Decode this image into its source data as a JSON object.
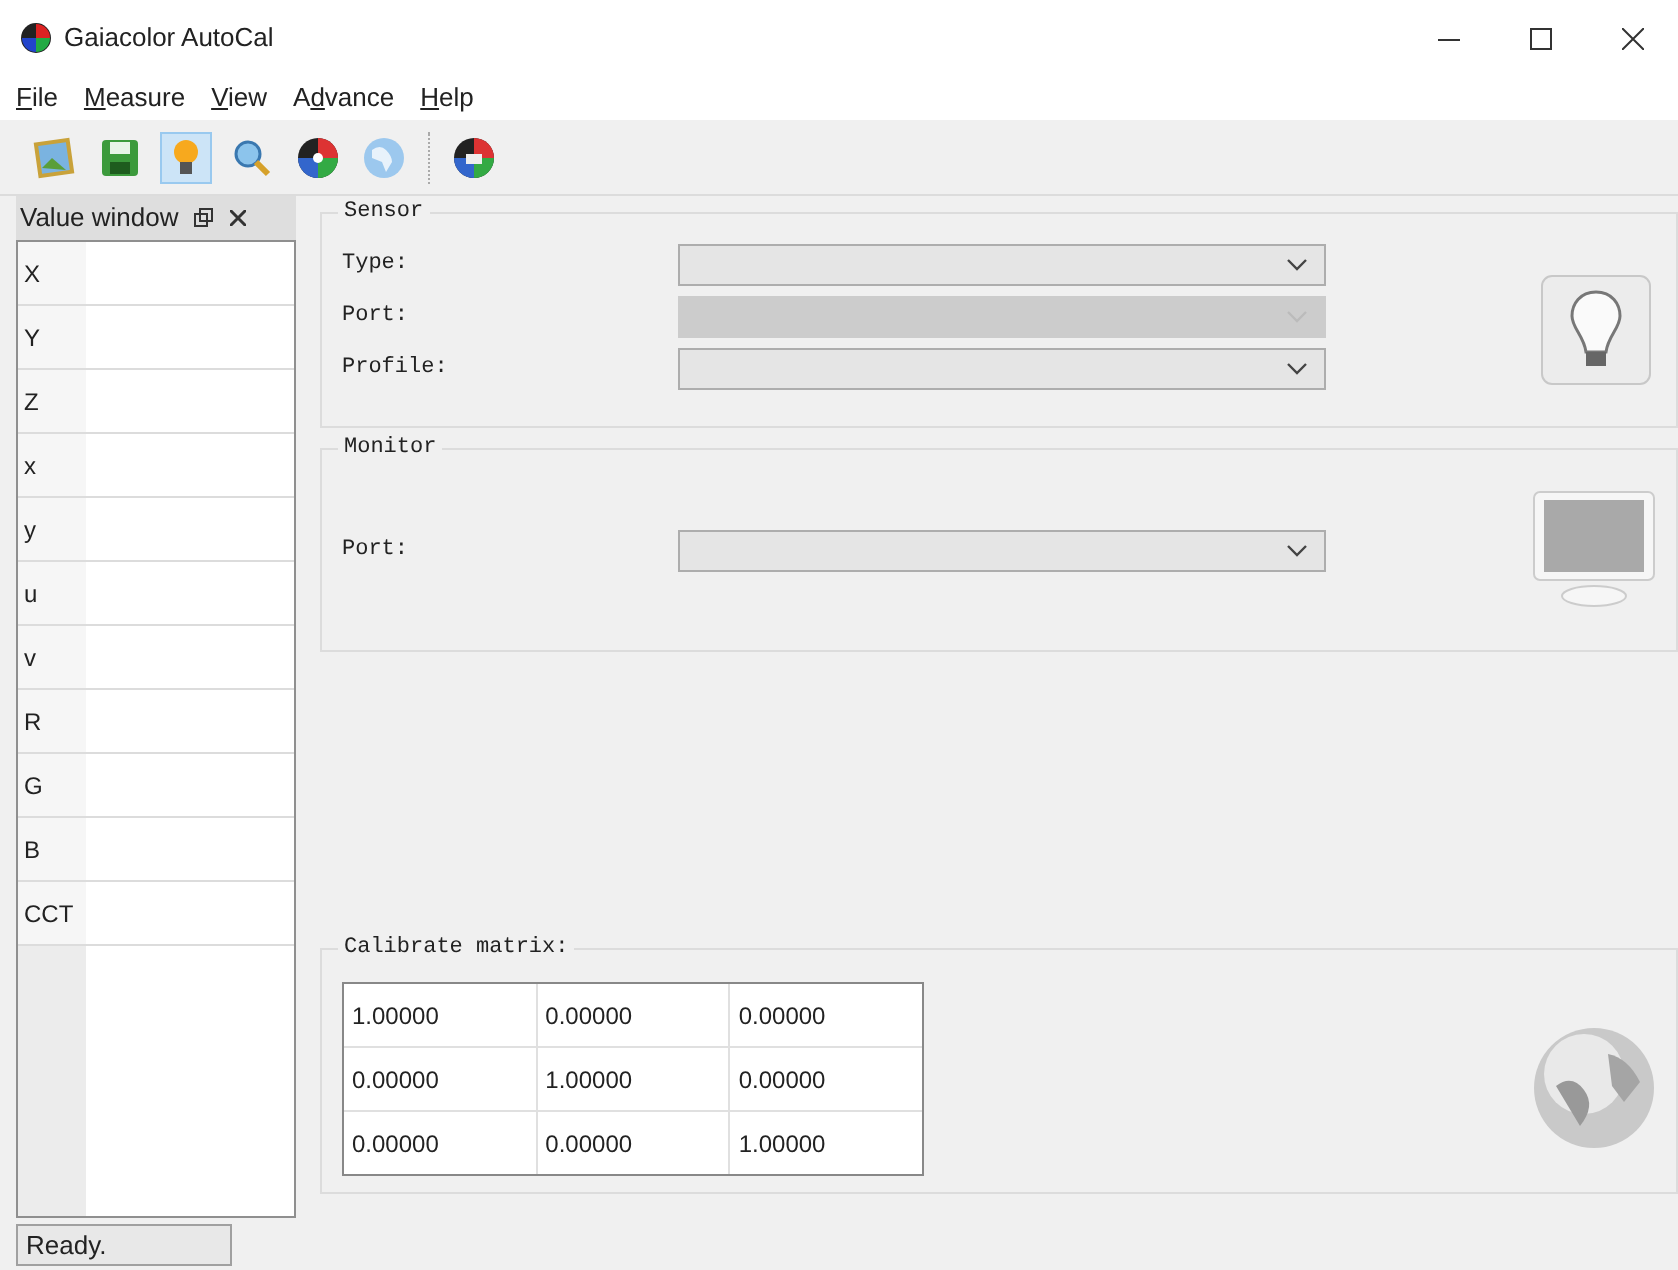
{
  "window": {
    "title": "Gaiacolor AutoCal"
  },
  "menu": [
    {
      "key": "F",
      "after": "ile"
    },
    {
      "key": "M",
      "after": "easure"
    },
    {
      "key": "V",
      "after": "iew"
    },
    {
      "before": "A",
      "key": "d",
      "after": "vance"
    },
    {
      "key": "H",
      "after": "elp"
    }
  ],
  "value_window": {
    "title": "Value window",
    "rows": [
      {
        "label": "X"
      },
      {
        "label": "Y"
      },
      {
        "label": "Z"
      },
      {
        "label": "x"
      },
      {
        "label": "y"
      },
      {
        "label": "u"
      },
      {
        "label": "v"
      },
      {
        "label": "R"
      },
      {
        "label": "G"
      },
      {
        "label": "B"
      },
      {
        "label": "CCT"
      }
    ]
  },
  "sensor": {
    "title": "Sensor",
    "fields": [
      {
        "label": "Type:",
        "disabled": false
      },
      {
        "label": "Port:",
        "disabled": true
      },
      {
        "label": "Profile:",
        "disabled": false
      }
    ]
  },
  "monitor": {
    "title": "Monitor",
    "fields": [
      {
        "label": "Port:",
        "disabled": false
      }
    ]
  },
  "calibrate": {
    "title": "Calibrate matrix:",
    "rows": [
      [
        "1.00000",
        "0.00000",
        "0.00000"
      ],
      [
        "0.00000",
        "1.00000",
        "0.00000"
      ],
      [
        "0.00000",
        "0.00000",
        "1.00000"
      ]
    ]
  },
  "status_bar": {
    "text": "Ready."
  }
}
